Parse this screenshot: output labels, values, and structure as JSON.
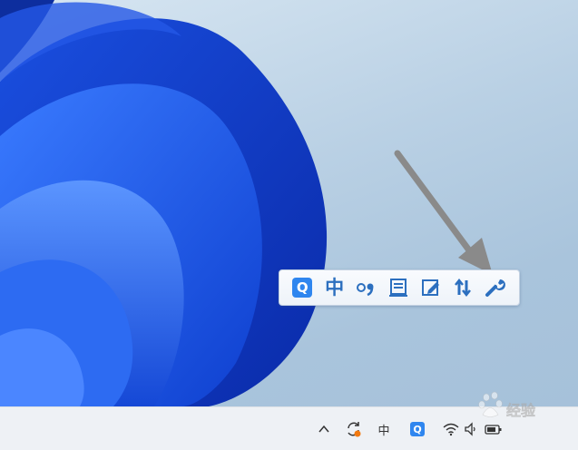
{
  "toolbar": {
    "logo_letter": "Q",
    "language_label": "中",
    "buttons": [
      {
        "icon": "punctuation-icon"
      },
      {
        "icon": "soft-keyboard-icon"
      },
      {
        "icon": "handwriting-icon"
      },
      {
        "icon": "toolbox-icon"
      },
      {
        "icon": "settings-wrench-icon"
      }
    ]
  },
  "taskbar": {
    "tray": {
      "ime_label": "中",
      "ime_logo_letter": "Q"
    }
  },
  "watermark": {
    "brand": "Baidu经验"
  },
  "colors": {
    "accent": "#2f86ef",
    "toolbar_icon": "#2c6fbf",
    "arrow": "#8a8a8a",
    "wallpaper_blue": "#0f3fcf"
  }
}
